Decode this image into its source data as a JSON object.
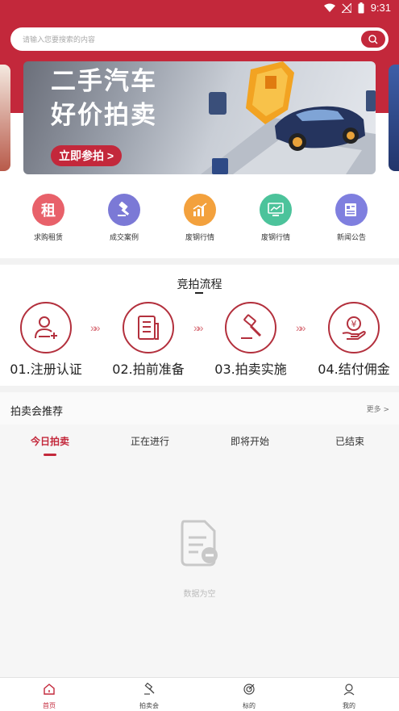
{
  "status_bar": {
    "time": "9:31"
  },
  "search": {
    "placeholder": "请输入您要搜索的内容"
  },
  "banner": {
    "title_line1": "二手汽车",
    "title_line2": "好价拍卖",
    "button_label": "立即参拍 >"
  },
  "quick_nav": [
    {
      "label": "求购租赁",
      "icon": "rent-icon",
      "glyph": "租",
      "color": "#e8616a"
    },
    {
      "label": "成交案例",
      "icon": "gavel-icon",
      "glyph": "",
      "color": "#7b79d6"
    },
    {
      "label": "废钢行情",
      "icon": "chart-up-icon",
      "glyph": "",
      "color": "#f3a13d"
    },
    {
      "label": "废钢行情",
      "icon": "monitor-chart-icon",
      "glyph": "",
      "color": "#4cc39b"
    },
    {
      "label": "新闻公告",
      "icon": "news-icon",
      "glyph": "",
      "color": "#7f7fdf"
    }
  ],
  "process": {
    "title": "竞拍流程",
    "steps": [
      {
        "label": "01.注册认证",
        "icon": "user-add-icon"
      },
      {
        "label": "02.拍前准备",
        "icon": "document-icon"
      },
      {
        "label": "03.拍卖实施",
        "icon": "gavel-icon"
      },
      {
        "label": "04.结付佣金",
        "icon": "yen-hand-icon"
      }
    ],
    "arrow_text": "»»"
  },
  "recommend": {
    "title": "拍卖会推荐",
    "more_label": "更多 >",
    "tabs": [
      {
        "label": "今日拍卖",
        "active": true
      },
      {
        "label": "正在进行",
        "active": false
      },
      {
        "label": "即将开始",
        "active": false
      },
      {
        "label": "已结束",
        "active": false
      }
    ],
    "empty_text": "数据为空"
  },
  "bottom_nav": [
    {
      "label": "首页",
      "icon": "home-icon",
      "active": true
    },
    {
      "label": "拍卖会",
      "icon": "gavel-icon",
      "active": false
    },
    {
      "label": "标的",
      "icon": "target-icon",
      "active": false
    },
    {
      "label": "我的",
      "icon": "user-icon",
      "active": false
    }
  ],
  "colors": {
    "brand": "#c3283b"
  }
}
